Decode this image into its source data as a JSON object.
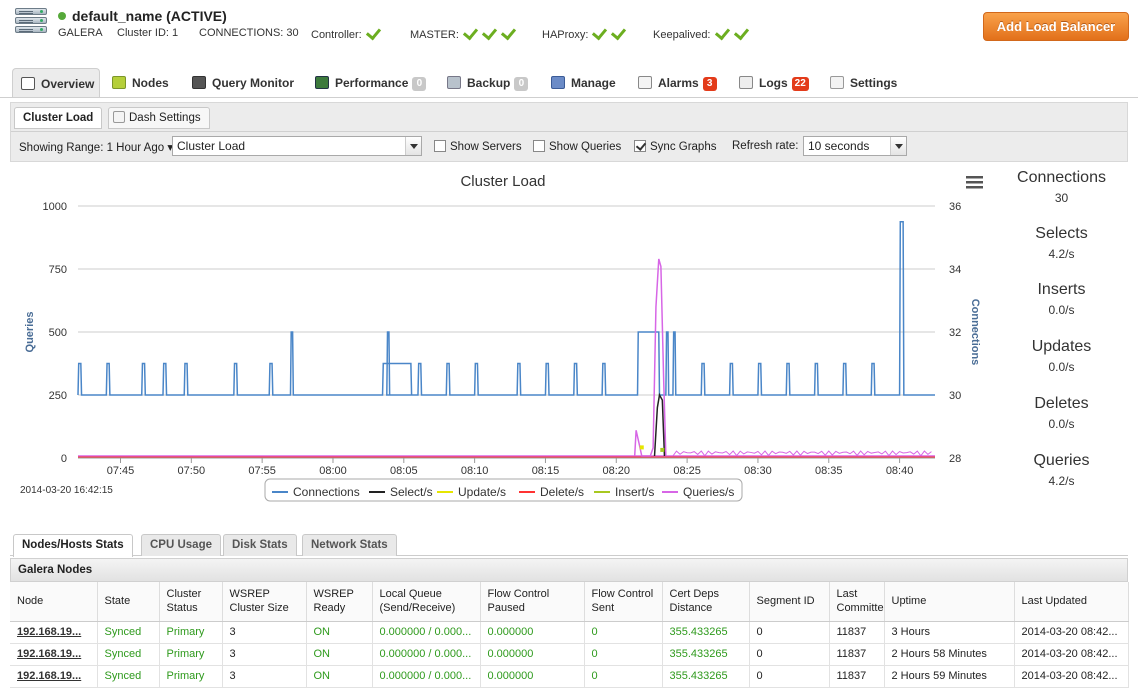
{
  "header": {
    "cluster_name": "default_name (ACTIVE)",
    "type": "GALERA",
    "cluster_id": "Cluster ID: 1",
    "connections": "CONNECTIONS: 30",
    "controller": "Controller:",
    "master": "MASTER:",
    "haproxy": "HAProxy:",
    "keepalived": "Keepalived:",
    "add_button": "Add Load Balancer"
  },
  "nav": {
    "tabs": [
      {
        "label": "Overview"
      },
      {
        "label": "Nodes"
      },
      {
        "label": "Query Monitor"
      },
      {
        "label": "Performance",
        "badge": "0"
      },
      {
        "label": "Backup",
        "badge": "0"
      },
      {
        "label": "Manage"
      },
      {
        "label": "Alarms",
        "badge": "3"
      },
      {
        "label": "Logs",
        "badge": "22"
      },
      {
        "label": "Settings"
      }
    ]
  },
  "subtabs": {
    "cluster_load": "Cluster Load",
    "dash_settings": "Dash Settings"
  },
  "toolbar": {
    "range_label": "Showing Range: 1 Hour Ago ▾",
    "graph_select": "Cluster Load",
    "show_servers": "Show Servers",
    "show_queries": "Show Queries",
    "sync_graphs": "Sync Graphs",
    "refresh_label": "Refresh rate:",
    "refresh_value": "10 seconds"
  },
  "chart_data": {
    "type": "line",
    "title": "Cluster Load",
    "ylabel": "Queries",
    "y2label": "Connections",
    "ylim": [
      0,
      1000
    ],
    "y2lim": [
      28,
      36
    ],
    "yticks": [
      "0",
      "250",
      "500",
      "750",
      "1000"
    ],
    "y2ticks": [
      "28",
      "30",
      "32",
      "34",
      "36"
    ],
    "xticks": [
      "07:45",
      "07:50",
      "07:55",
      "08:00",
      "08:05",
      "08:10",
      "08:15",
      "08:20",
      "08:25",
      "08:30",
      "08:35",
      "08:40"
    ],
    "timestamp": "2014-03-20 16:42:15",
    "legend": [
      "Connections",
      "Select/s",
      "Update/s",
      "Delete/s",
      "Insert/s",
      "Queries/s"
    ],
    "colors": [
      "#4a86c8",
      "#222222",
      "#e6e600",
      "#ff3333",
      "#a8c820",
      "#d766e6"
    ],
    "connections": {
      "baseline": 30,
      "spikes_31": [
        "07:42",
        "07:44",
        "07:46.5",
        "07:48",
        "07:49.5",
        "07:53",
        "07:55.5",
        "08:06",
        "08:08",
        "08:10",
        "08:13",
        "08:15",
        "08:17",
        "08:19",
        "08:26",
        "08:28",
        "08:30",
        "08:32",
        "08:34",
        "08:36",
        "08:38"
      ],
      "note_blocks": [
        {
          "from": "08:03.5",
          "to": "08:05.5",
          "value": 31
        },
        {
          "from": "08:21.5",
          "to": "08:23",
          "value": 32
        }
      ],
      "spikes_32": [
        "07:57",
        "08:03.8",
        "08:23.5",
        "08:24"
      ],
      "peak": {
        "time": "08:40",
        "value": 35.5
      }
    },
    "queries_peak": {
      "time": "08:23",
      "value": 790
    },
    "select_peak": {
      "time": "08:23",
      "value": 250
    }
  },
  "stats": [
    {
      "label": "Connections",
      "value": "30"
    },
    {
      "label": "Selects",
      "value": "4.2/s"
    },
    {
      "label": "Inserts",
      "value": "0.0/s"
    },
    {
      "label": "Updates",
      "value": "0.0/s"
    },
    {
      "label": "Deletes",
      "value": "0.0/s"
    },
    {
      "label": "Queries",
      "value": "4.2/s"
    }
  ],
  "bottom_tabs": [
    "Nodes/Hosts Stats",
    "CPU Usage",
    "Disk Stats",
    "Network Stats"
  ],
  "galera": {
    "title": "Galera Nodes",
    "columns": [
      "Node",
      "State",
      "Cluster Status",
      "WSREP Cluster Size",
      "WSREP Ready",
      "Local Queue (Send/Receive)",
      "Flow Control Paused",
      "Flow Control Sent",
      "Cert Deps Distance",
      "Segment ID",
      "Last Committe",
      "Uptime",
      "Last Updated"
    ],
    "rows": [
      [
        "192.168.19...",
        "Synced",
        "Primary",
        "3",
        "ON",
        "0.000000 / 0.000...",
        "0.000000",
        "0",
        "355.433265",
        "0",
        "11837",
        "3 Hours",
        "2014-03-20 08:42..."
      ],
      [
        "192.168.19...",
        "Synced",
        "Primary",
        "3",
        "ON",
        "0.000000 / 0.000...",
        "0.000000",
        "0",
        "355.433265",
        "0",
        "11837",
        "2 Hours 58 Minutes",
        "2014-03-20 08:42..."
      ],
      [
        "192.168.19...",
        "Synced",
        "Primary",
        "3",
        "ON",
        "0.000000 / 0.000...",
        "0.000000",
        "0",
        "355.433265",
        "0",
        "11837",
        "2 Hours 59 Minutes",
        "2014-03-20 08:42..."
      ]
    ]
  }
}
